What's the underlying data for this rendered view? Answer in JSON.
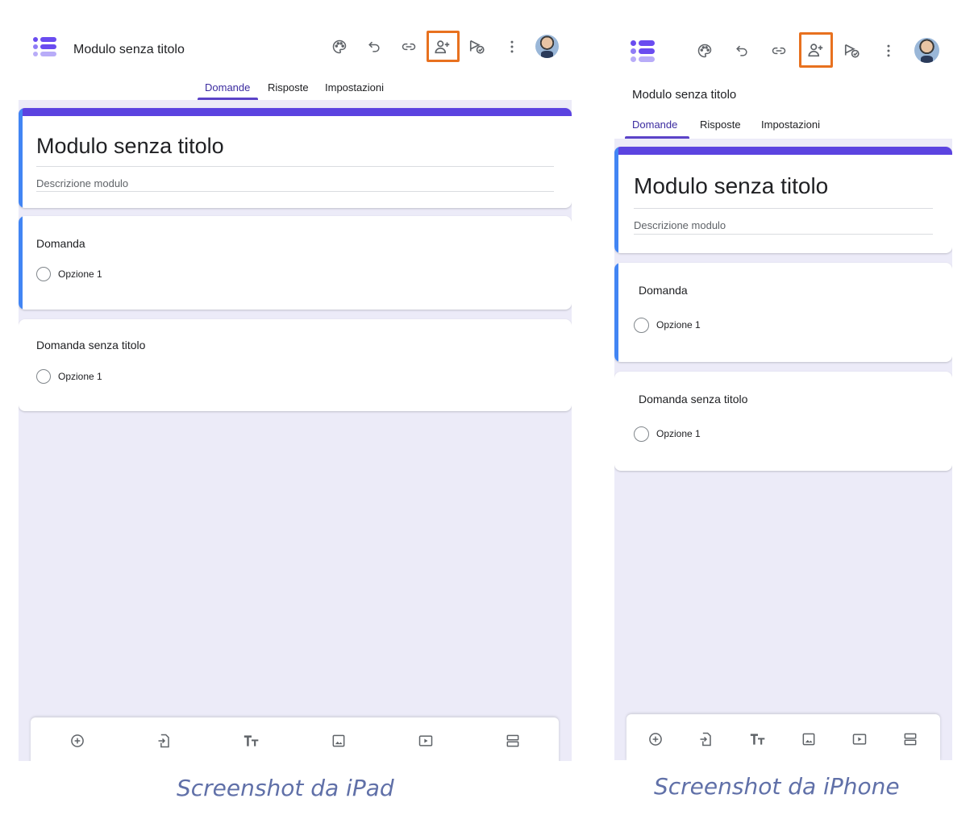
{
  "ipad": {
    "doc_title": "Modulo senza titolo",
    "toolbar_icons": [
      "palette-icon",
      "undo-icon",
      "link-icon",
      "add-collaborator-icon",
      "preview-icon",
      "more-vert-icon",
      "avatar"
    ],
    "tabs": [
      {
        "label": "Domande",
        "active": true
      },
      {
        "label": "Risposte",
        "active": false
      },
      {
        "label": "Impostazioni",
        "active": false
      }
    ],
    "form_title": "Modulo senza titolo",
    "form_description": "Descrizione modulo",
    "questions": [
      {
        "title": "Domanda",
        "option": "Opzione 1",
        "selected": true
      },
      {
        "title": "Domanda senza titolo",
        "option": "Opzione 1",
        "selected": false
      }
    ],
    "bottom_icons": [
      "add-question-icon",
      "import-questions-icon",
      "add-title-icon",
      "add-image-icon",
      "add-video-icon",
      "add-section-icon"
    ]
  },
  "iphone": {
    "doc_title": "Modulo senza titolo",
    "tabs": [
      {
        "label": "Domande",
        "active": true
      },
      {
        "label": "Risposte",
        "active": false
      },
      {
        "label": "Impostazioni",
        "active": false
      }
    ],
    "form_title": "Modulo senza titolo",
    "form_description": "Descrizione modulo",
    "questions": [
      {
        "title": "Domanda",
        "option": "Opzione 1",
        "selected": true
      },
      {
        "title": "Domanda senza titolo",
        "option": "Opzione 1",
        "selected": false
      }
    ]
  },
  "captions": {
    "ipad": "Screenshot da iPad",
    "iphone": "Screenshot da iPhone"
  },
  "colors": {
    "accent_purple": "#5b43e0",
    "selected_blue": "#4285f4",
    "highlight_orange": "#e8711f",
    "canvas_lavender": "#ecebf8",
    "caption": "#6070a8"
  }
}
